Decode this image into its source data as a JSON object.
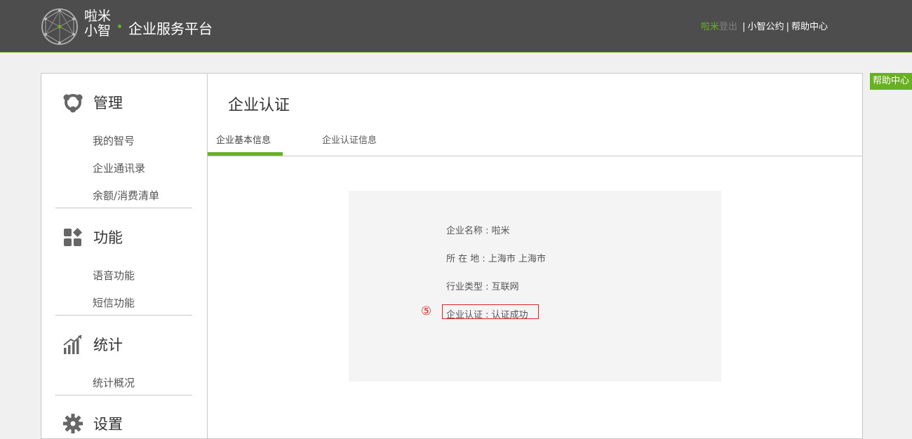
{
  "header": {
    "brand_line1": "啦米",
    "brand_line2": "小智",
    "platform": "企业服务平台",
    "user": "啦米",
    "logout": "登出",
    "links": [
      "小智公约",
      "帮助中心"
    ],
    "separator": "|"
  },
  "float_help": "帮助中心",
  "sidebar": {
    "sections": [
      {
        "title": "管理",
        "icon": "manage-icon",
        "items": [
          "我的智号",
          "企业通讯录",
          "余额/消费清单"
        ]
      },
      {
        "title": "功能",
        "icon": "function-icon",
        "items": [
          "语音功能",
          "短信功能"
        ]
      },
      {
        "title": "统计",
        "icon": "statistics-icon",
        "items": [
          "统计概况"
        ]
      },
      {
        "title": "设置",
        "icon": "settings-icon",
        "items": []
      }
    ]
  },
  "main": {
    "title": "企业认证",
    "tabs": [
      "企业基本信息",
      "企业认证信息"
    ],
    "active_tab": 0,
    "info": [
      {
        "label": "企业名称",
        "value": "啦米"
      },
      {
        "label": "所 在 地",
        "value": "上海市 上海市"
      },
      {
        "label": "行业类型",
        "value": "互联网"
      },
      {
        "label": "企业认证",
        "value": "认证成功"
      }
    ],
    "step_marker": "⑤"
  },
  "colors": {
    "accent": "#6ab023",
    "topbar": "#4d4d4d",
    "highlight": "#dd2222"
  }
}
